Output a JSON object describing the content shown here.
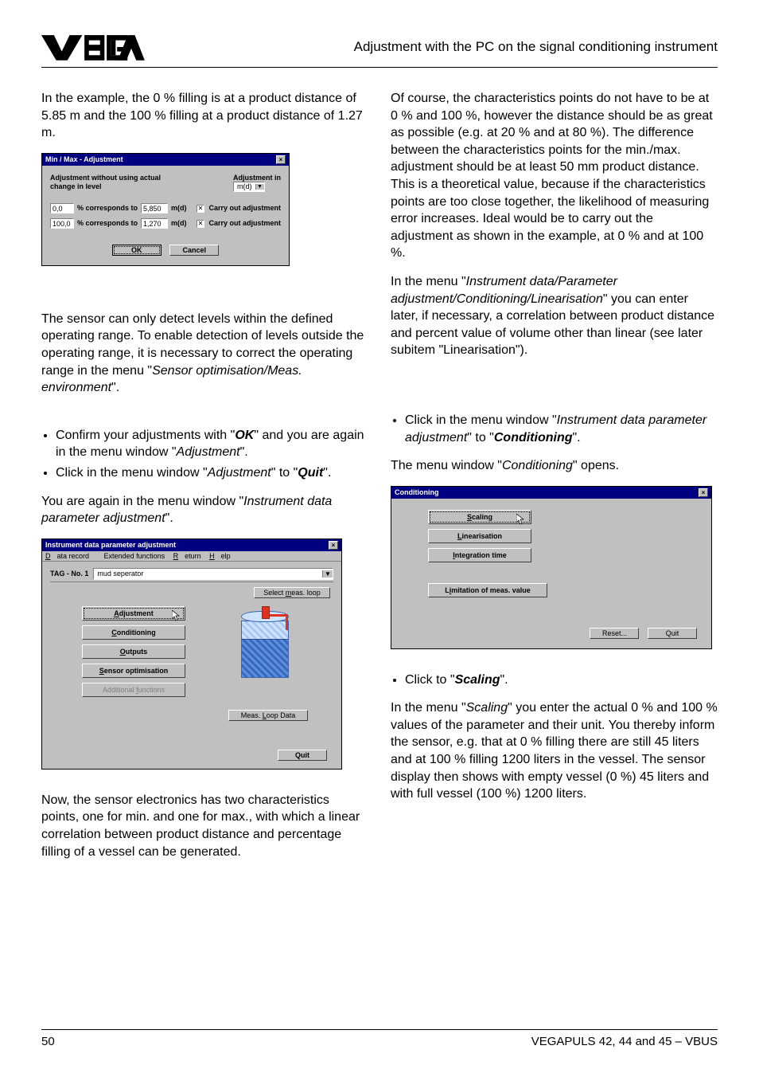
{
  "header": {
    "title": "Adjustment with the PC on the signal conditioning instrument"
  },
  "left": {
    "p1": "In the example, the 0 % filling is at a product distance of 5.85 m and the 100 % filling at a product distance of 1.27 m.",
    "p2_a": "The sensor can only detect levels within the defined operating range. To enable detection of levels outside the operating range, it is necessary to correct the operating range in the menu \"",
    "p2_i": "Sensor optimisation/Meas. environment",
    "p2_b": "\".",
    "b1_a": "Confirm your adjustments with \"",
    "b1_ok": "OK",
    "b1_b": "\" and you are again in the menu window \"",
    "b1_i": "Adjustment",
    "b1_c": "\".",
    "b2_a": "Click in the menu window \"",
    "b2_i": "Adjustment",
    "b2_b": "\" to \"",
    "b2_q": "Quit",
    "b2_c": "\".",
    "p3_a": "You are again in the menu window \"",
    "p3_i": "Instrument data parameter adjustment",
    "p3_b": "\".",
    "p4": "Now, the sensor electronics has two characteristics points, one for min. and one for max., with which a linear correlation between product distance and percentage filling of a vessel can be generated."
  },
  "right": {
    "p1": "Of course, the characteristics points do not have to be at 0 % and 100 %, however the distance should be as great as possible (e.g. at 20 % and at 80 %). The difference between the characteristics points for the min./max. adjustment should be at least 50 mm product distance. This is a theoretical value, because if the characteristics points are too close together, the likelihood of measuring error increases. Ideal would be to carry out the adjustment as shown in the example, at 0 % and at 100 %.",
    "p2_a": "In the menu \"",
    "p2_i": "Instrument data/Parameter adjustment/Conditioning/Linearisation",
    "p2_b": "\" you can enter later, if necessary, a correlation between product distance and percent value of volume other than linear (see later subitem \"Linearisation\").",
    "b1_a": "Click in the menu window \"",
    "b1_i": "Instrument data parameter adjustment",
    "b1_b": "\" to \"",
    "b1_cond": "Conditioning",
    "b1_c": "\".",
    "p3_a": "The menu window \"",
    "p3_i": "Conditioning",
    "p3_b": "\" opens.",
    "b2_a": "Click to \"",
    "b2_s": "Scaling",
    "b2_b": "\".",
    "p4_a": "In the menu \"",
    "p4_i": "Scaling",
    "p4_b": "\" you enter the actual 0 % and 100 % values of the parameter and their unit. You thereby inform the sensor, e.g. that at 0 % filling there are still 45 liters and at 100 % filling 1200 liters in the vessel. The sensor display then shows with empty vessel (0 %) 45 liters and with full vessel (100 %) 1200 liters."
  },
  "dlg1": {
    "title": "Min / Max - Adjustment",
    "left_label": "Adjustment without using actual change in level",
    "right_label": "Adjustment in",
    "unit": "m(d)",
    "pct0": "0,0",
    "corresp": "%  corresponds to",
    "v0": "5,850",
    "uom": "m(d)",
    "pct1": "100,0",
    "v1": "1,270",
    "carry": "Carry out adjustment",
    "ok": "OK",
    "cancel": "Cancel"
  },
  "dlg2": {
    "title": "Instrument data parameter adjustment",
    "menu_data": "Data record",
    "menu_ext": "Extended functions",
    "menu_ret": "Return",
    "menu_help": "Help",
    "tag_label": "TAG - No. 1",
    "tag_desc": "mud seperator",
    "select_loop": "Select meas. loop",
    "btn_adj": "Adjustment",
    "btn_cond": "Conditioning",
    "btn_out": "Outputs",
    "btn_sens": "Sensor optimisation",
    "btn_add": "Additional functions",
    "loop_data": "Meas. Loop Data",
    "quit": "Quit"
  },
  "dlg3": {
    "title": "Conditioning",
    "btn_scaling": "Scaling",
    "btn_lin": "Linearisation",
    "btn_int": "Integration time",
    "btn_lim": "Limitation of meas. value",
    "reset": "Reset...",
    "quit": "Quit"
  },
  "footer": {
    "page": "50",
    "doc": "VEGAPULS 42, 44 and 45 – VBUS"
  }
}
